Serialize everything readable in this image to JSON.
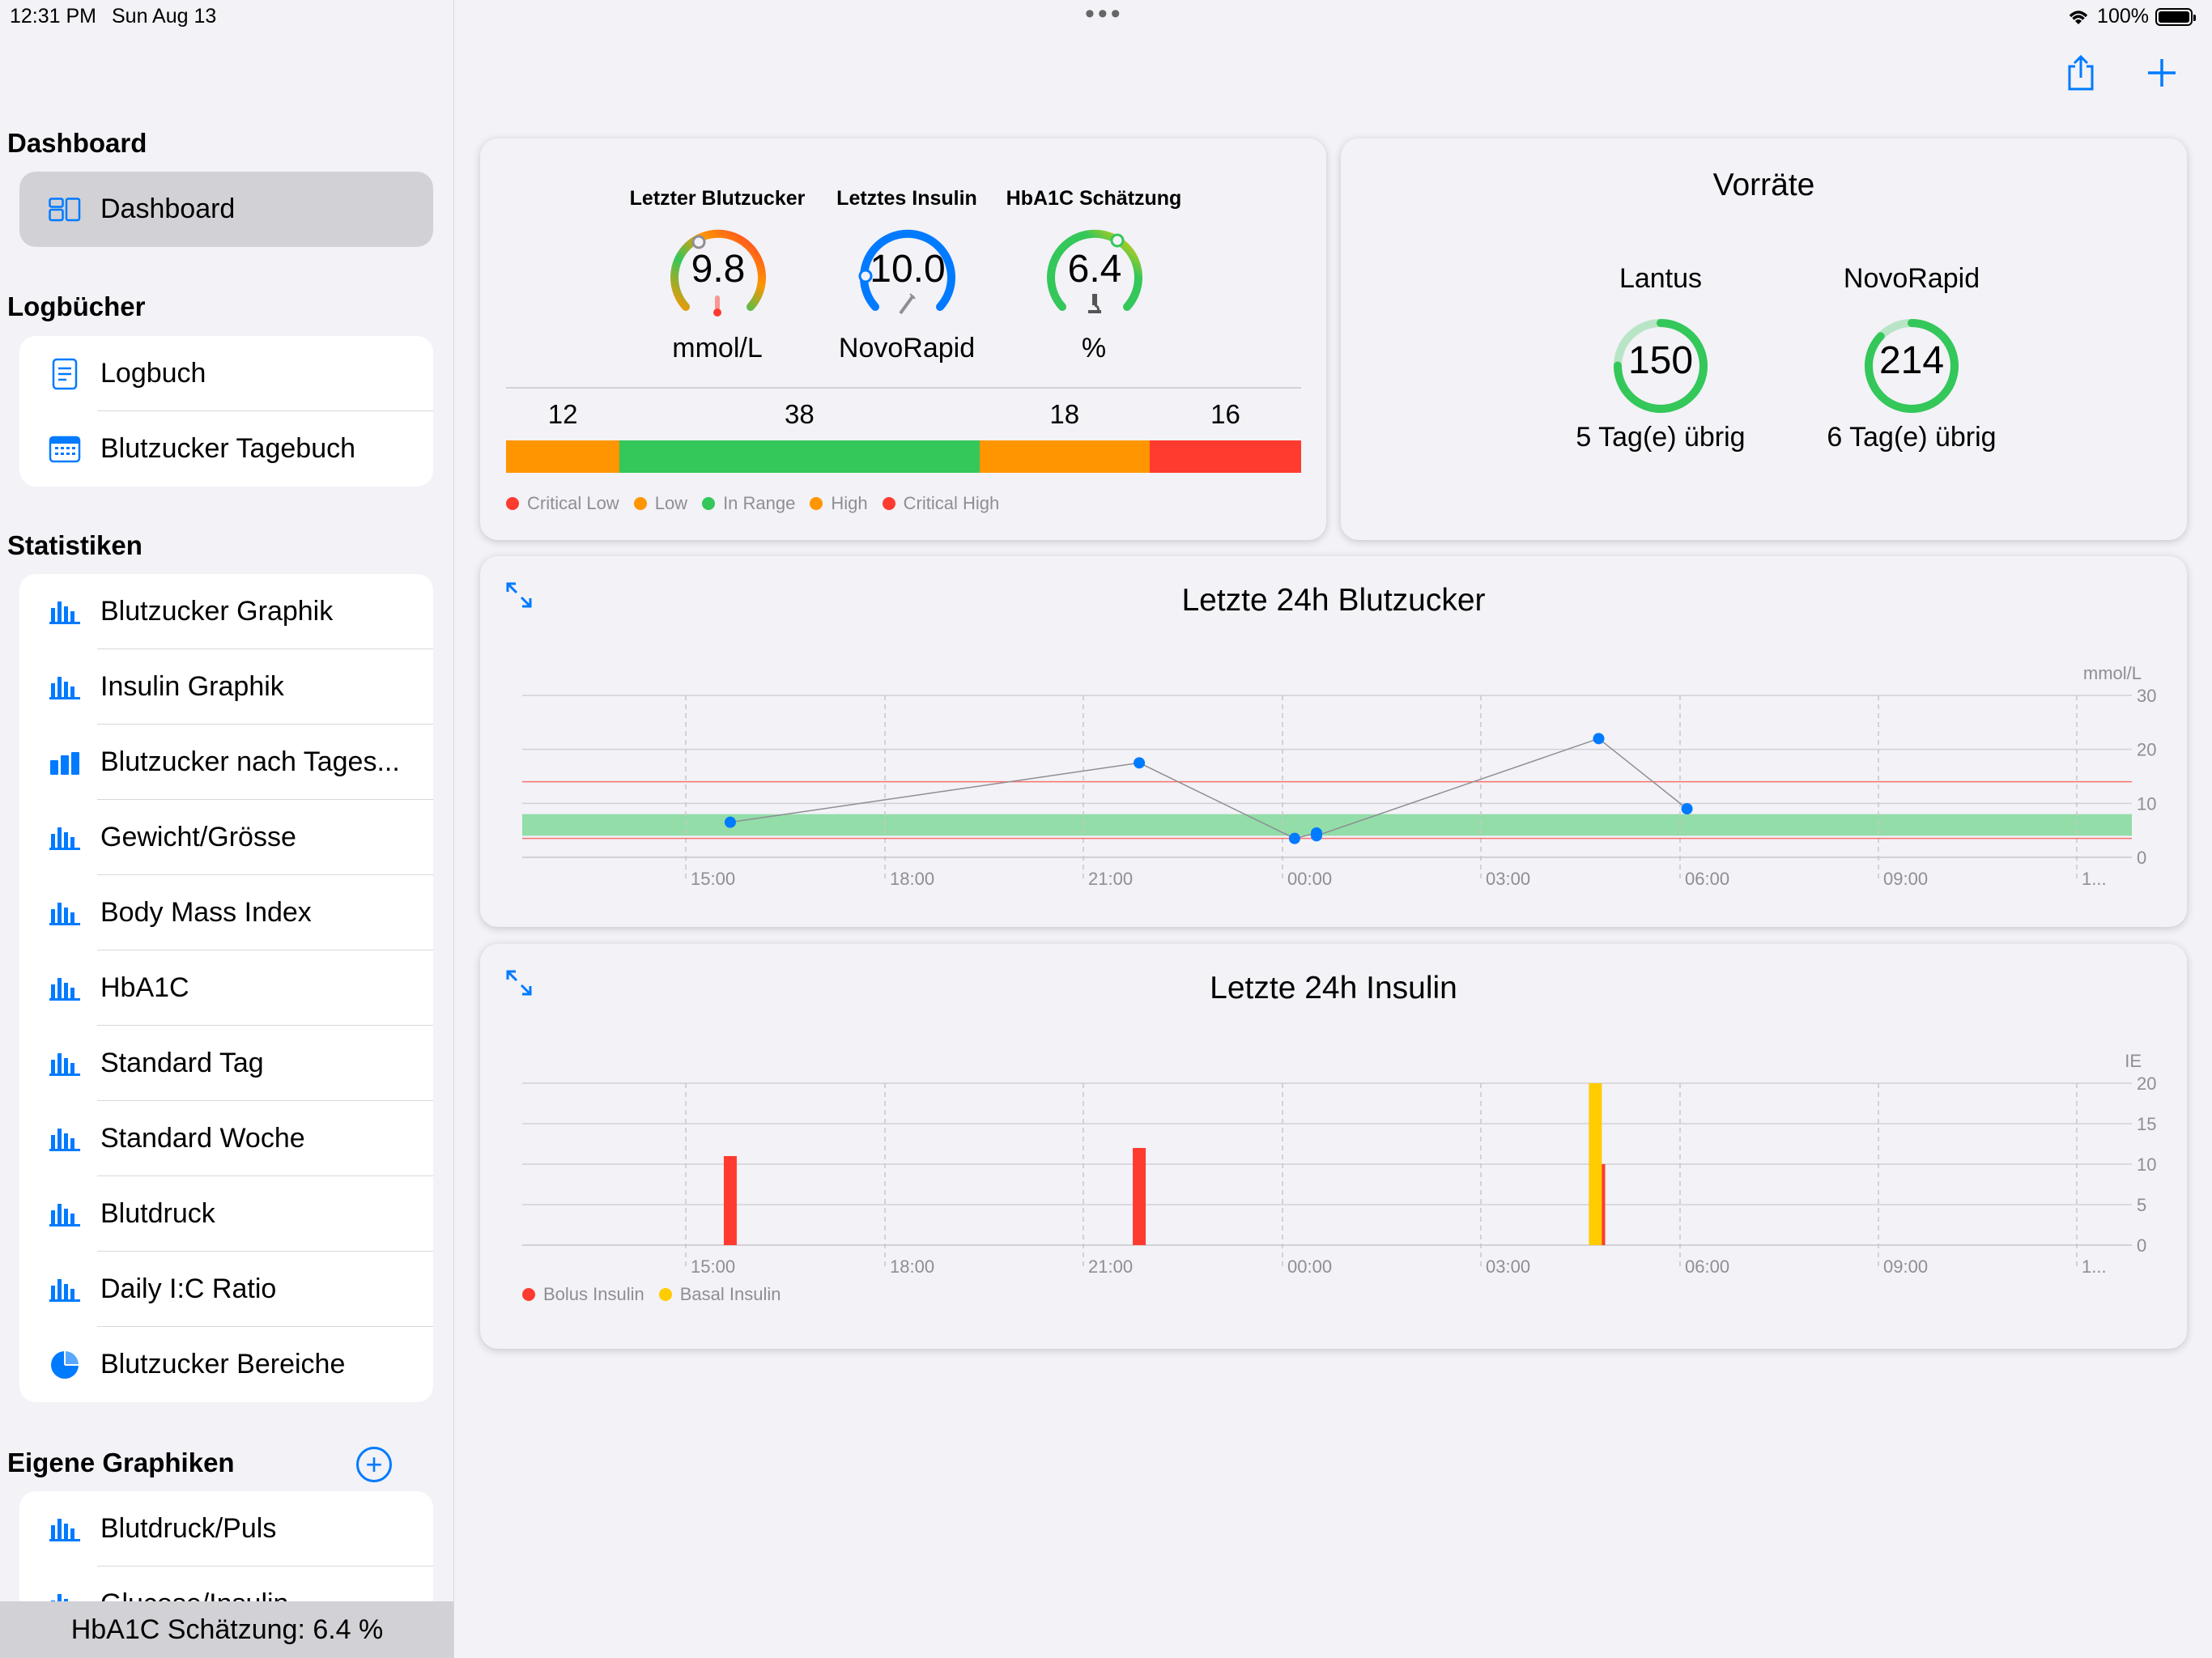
{
  "status": {
    "time": "12:31 PM",
    "date": "Sun Aug 13",
    "battery": "100%"
  },
  "sidebar": {
    "dashboard_section": "Dashboard",
    "dashboard_item": "Dashboard",
    "logbooks_section": "Logbücher",
    "logbooks": [
      "Logbuch",
      "Blutzucker Tagebuch"
    ],
    "stats_section": "Statistiken",
    "stats": [
      "Blutzucker Graphik",
      "Insulin Graphik",
      "Blutzucker nach Tages...",
      "Gewicht/Grösse",
      "Body Mass Index",
      "HbA1C",
      "Standard Tag",
      "Standard Woche",
      "Blutdruck",
      "Daily I:C Ratio",
      "Blutzucker Bereiche"
    ],
    "custom_section": "Eigene Graphiken",
    "custom": [
      "Blutdruck/Puls",
      "Glucose/Insulin"
    ],
    "bottom_status": "HbA1C Schätzung: 6.4 %"
  },
  "summary": {
    "gauges": [
      {
        "label": "Letzter Blutzucker",
        "value": "9.8",
        "unit": "mmol/L"
      },
      {
        "label": "Letztes Insulin",
        "value": "10.0",
        "unit": "NovoRapid"
      },
      {
        "label": "HbA1C Schätzung",
        "value": "6.4",
        "unit": "%"
      }
    ],
    "range_values": [
      12,
      38,
      18,
      16
    ],
    "range_labels": [
      "12",
      "38",
      "18",
      "16"
    ],
    "range_colors": [
      "#ff9500",
      "#34c759",
      "#ff9500",
      "#ff3b30"
    ],
    "legend": [
      {
        "label": "Critical Low",
        "color": "#ff3b30"
      },
      {
        "label": "Low",
        "color": "#ff9500"
      },
      {
        "label": "In Range",
        "color": "#34c759"
      },
      {
        "label": "High",
        "color": "#ff9500"
      },
      {
        "label": "Critical High",
        "color": "#ff3b30"
      }
    ]
  },
  "supplies": {
    "title": "Vorräte",
    "items": [
      {
        "name": "Lantus",
        "value": "150",
        "days": "5 Tag(e) übrig"
      },
      {
        "name": "NovoRapid",
        "value": "214",
        "days": "6 Tag(e) übrig"
      }
    ]
  },
  "chart_data": [
    {
      "type": "scatter",
      "title": "Letzte 24h Blutzucker",
      "ylabel": "mmol/L",
      "x_ticks": [
        "15:00",
        "18:00",
        "21:00",
        "00:00",
        "03:00",
        "06:00",
        "09:00",
        "1..."
      ],
      "y_ticks": [
        0,
        10,
        20,
        30
      ],
      "ylim": [
        0,
        30
      ],
      "target_range": [
        4,
        8
      ],
      "high_line": 14,
      "low_line": 3.5,
      "series": [
        {
          "x": [
            "15:40",
            "21:80",
            "00:20",
            "00:40",
            "00:40",
            "04:45",
            "06:05"
          ],
          "hours": [
            15.67,
            21.83,
            0.17,
            0.5,
            0.5,
            4.75,
            6.08
          ],
          "values": [
            6.5,
            17.5,
            3.5,
            4.5,
            4.0,
            22.0,
            9.0
          ]
        }
      ]
    },
    {
      "type": "bar",
      "title": "Letzte 24h Insulin",
      "ylabel": "IE",
      "x_ticks": [
        "15:00",
        "18:00",
        "21:00",
        "00:00",
        "03:00",
        "06:00",
        "09:00",
        "1..."
      ],
      "y_ticks": [
        0,
        5,
        10,
        15,
        20
      ],
      "ylim": [
        0,
        20
      ],
      "series": [
        {
          "name": "Bolus Insulin",
          "color": "#ff3b30",
          "hours": [
            15.67,
            21.83,
            4.75
          ],
          "values": [
            11,
            12,
            10
          ]
        },
        {
          "name": "Basal Insulin",
          "color": "#ffcc00",
          "hours": [
            4.7
          ],
          "values": [
            20
          ]
        }
      ]
    }
  ]
}
